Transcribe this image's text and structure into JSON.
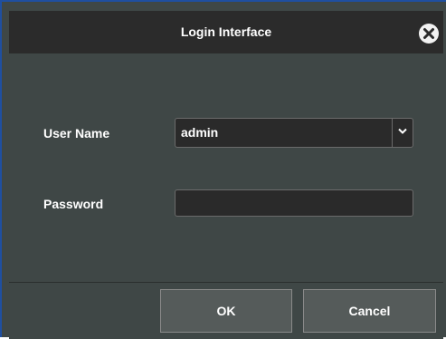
{
  "window": {
    "title": "Login Interface"
  },
  "icons": {
    "close": "close-circle-icon",
    "dropdown": "chevron-down-icon"
  },
  "form": {
    "username_label": "User Name",
    "username_value": "admin",
    "password_label": "Password",
    "password_value": ""
  },
  "buttons": {
    "ok": "OK",
    "cancel": "Cancel"
  },
  "colors": {
    "titlebar": "#2b2b2b",
    "panel": "#3f4746",
    "field": "#2a2a2a",
    "button": "#555b5a",
    "border_accent": "#1f4fa0"
  }
}
